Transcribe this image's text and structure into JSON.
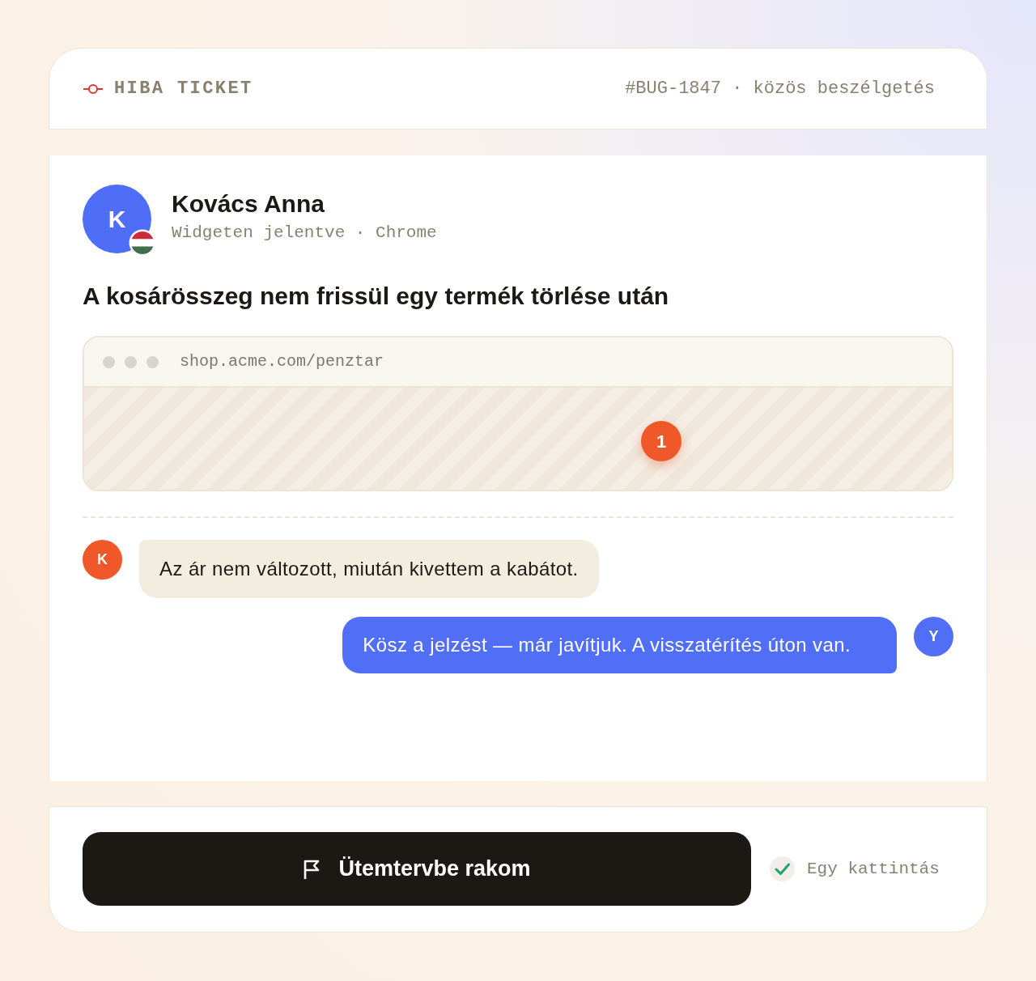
{
  "header": {
    "title": "HIBA TICKET",
    "ticket_info": "#BUG-1847 · közös beszélgetés"
  },
  "reporter": {
    "initial": "K",
    "name": "Kovács Anna",
    "source": "Widgeten jelentve · Chrome"
  },
  "issue_title": "A kosárösszeg nem frissül egy termék törlése után",
  "screenshot": {
    "url": "shop.acme.com/penztar",
    "markers": [
      {
        "label": "1"
      }
    ]
  },
  "messages": [
    {
      "kind": "customer",
      "initial": "K",
      "text": "Az ár nem változott, miután kivettem a kabátot."
    },
    {
      "kind": "agent",
      "initial": "Y",
      "text": "Kösz a jelzést — már javítjuk. A visszatérítés úton van."
    }
  ],
  "footer": {
    "button": "Ütemtervbe rakom",
    "note": "Egy kattintás"
  }
}
